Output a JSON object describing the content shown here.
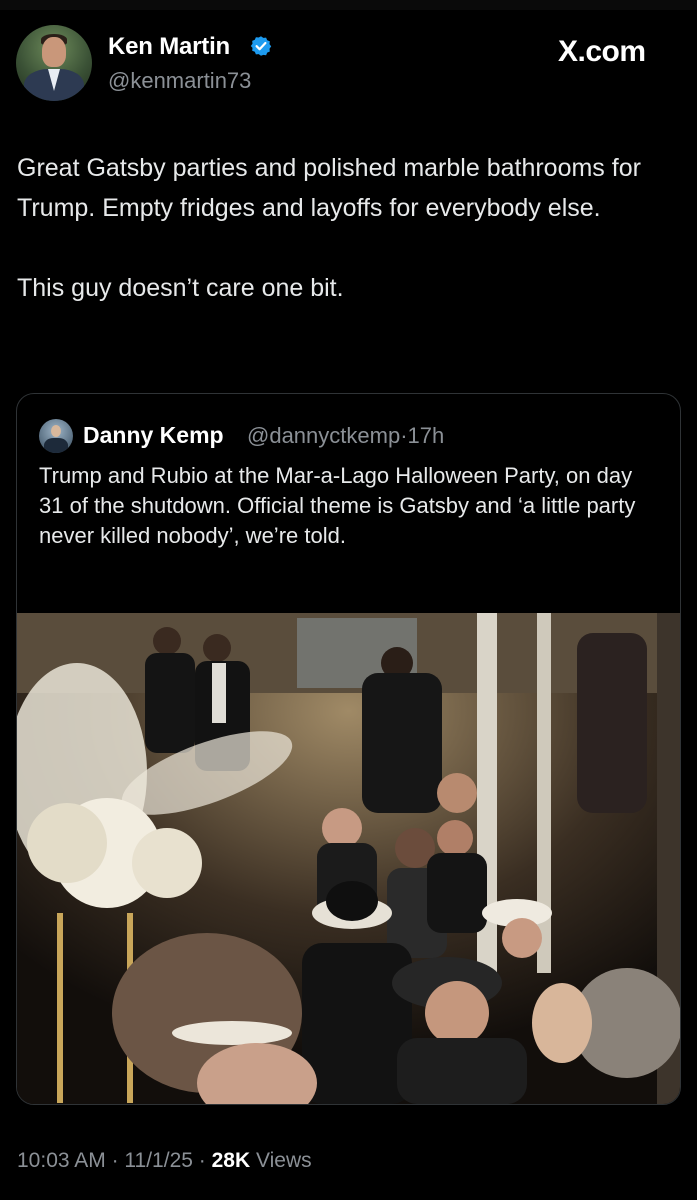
{
  "tweet": {
    "author": {
      "name": "Ken Martin",
      "handle": "@kenmartin73",
      "verified": true
    },
    "source_label": "X.com",
    "text": [
      "Great Gatsby parties and polished marble bathrooms for Trump. Empty fridges and layoffs for everybody else.",
      "This guy doesn’t care one bit."
    ],
    "quote": {
      "author_name": "Danny Kemp",
      "handle": "@dannyctkemp",
      "separator": "·",
      "time": "17h",
      "text": "Trump and Rubio at the Mar-a-Lago Halloween Party, on day 31 of the shutdown. Official theme is Gatsby and ‘a little party never killed nobody’, we’re told."
    },
    "meta": {
      "time": "10:03 AM",
      "date": "11/1/25",
      "views_count": "28K",
      "views_label": "Views",
      "separator": "·"
    }
  },
  "colors": {
    "background": "#000000",
    "text_primary": "#e7e9ea",
    "text_secondary": "#8b9096",
    "verified_badge": "#1d9bf0",
    "border": "#2f3336"
  },
  "icons": {
    "verified": "verified-badge-icon"
  }
}
